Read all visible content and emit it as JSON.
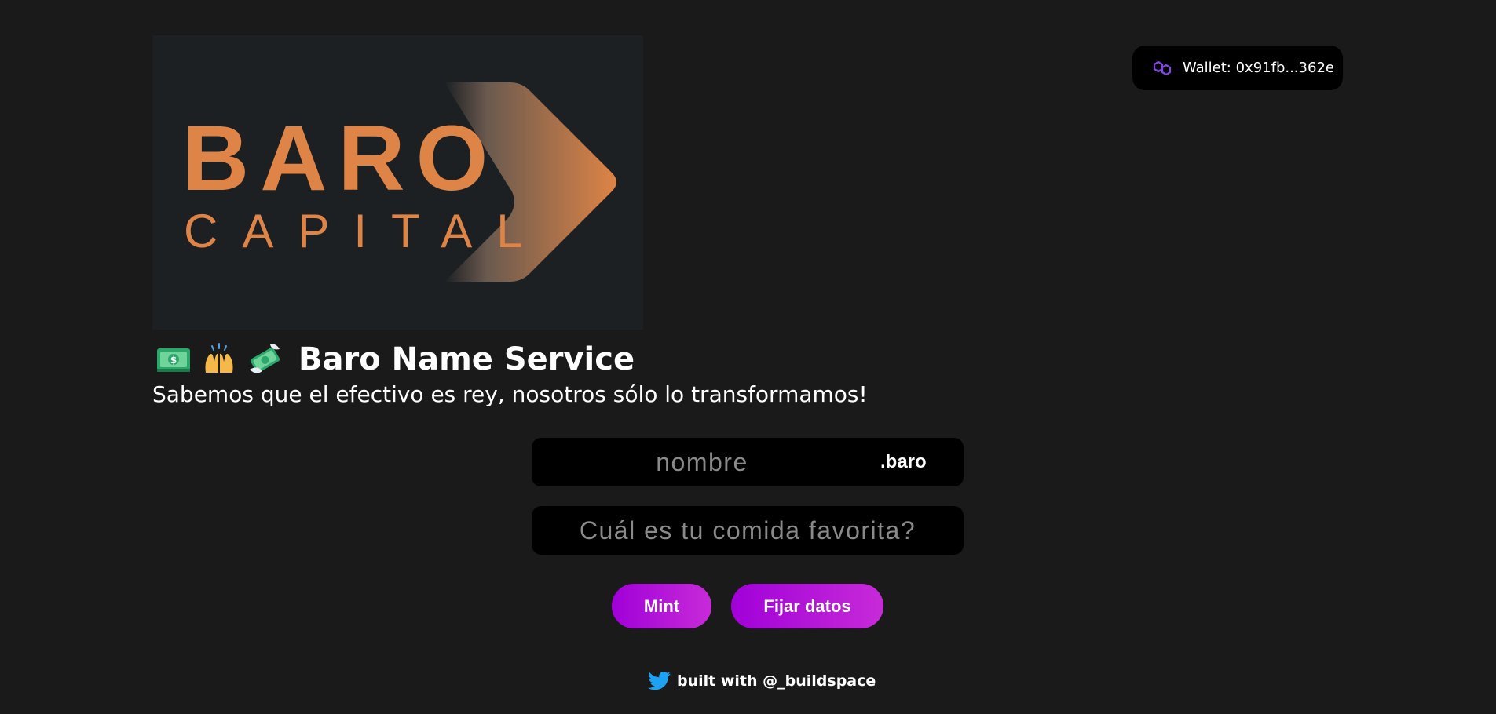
{
  "logo": {
    "line1": "BARO",
    "line2": "CAPITAL",
    "brand_color": "#de8446",
    "background": "#1d2023"
  },
  "wallet": {
    "label": "Wallet: 0x91fb...362e",
    "icon": "polygon-icon",
    "icon_color": "#8247e5"
  },
  "header": {
    "emojis": [
      "money-bill-emoji",
      "raising-hands-emoji",
      "money-with-wings-emoji"
    ],
    "title": "Baro Name Service",
    "subtitle": "Sabemos que el efectivo es rey, nosotros sólo lo transformamos!"
  },
  "form": {
    "domain_placeholder": "nombre",
    "domain_value": "",
    "tld": ".baro",
    "record_placeholder": "Cuál es tu comida favorita?",
    "record_value": "",
    "mint_label": "Mint",
    "set_label": "Fijar datos",
    "button_gradient": [
      "#a100d8",
      "#c72bd8"
    ]
  },
  "footer": {
    "icon": "twitter-icon",
    "icon_color": "#1da1f2",
    "link_text": "built with @_buildspace"
  }
}
